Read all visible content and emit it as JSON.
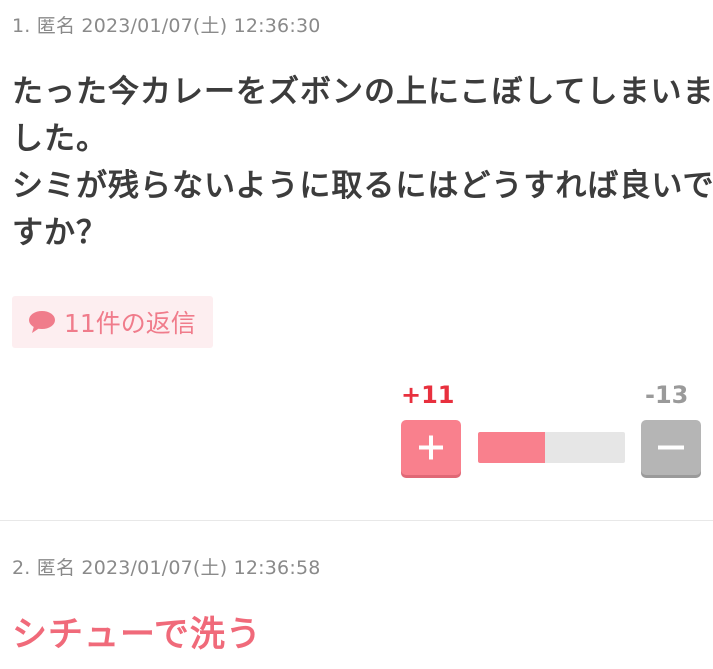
{
  "comments": [
    {
      "meta": "1. 匿名 2023/01/07(土) 12:36:30",
      "lines": [
        "たった今カレーをズボンの上にこぼしてしまいま",
        "した。",
        "シミが残らないように取るにはどうすれば良いで",
        "すか？"
      ],
      "reply_label": "11件の返信",
      "plus_count": "+11",
      "minus_count": "-13",
      "vote_ratio": 0.458
    },
    {
      "meta": "2. 匿名 2023/01/07(土) 12:36:58",
      "text": "シチューで洗う"
    }
  ],
  "icons": {
    "reply": "speech-bubble-icon",
    "plus": "plus-icon",
    "minus": "minus-icon"
  },
  "colors": {
    "accent": "#f9808d",
    "plus_count": "#e8303e",
    "minus_count": "#9a9a9a",
    "neutral_button": "#b5b5b5",
    "bar_track": "#e6e6e6",
    "reply_bg": "#fdeef0",
    "reply_text": "#f07c8b",
    "answer_text": "#f06a7a"
  }
}
